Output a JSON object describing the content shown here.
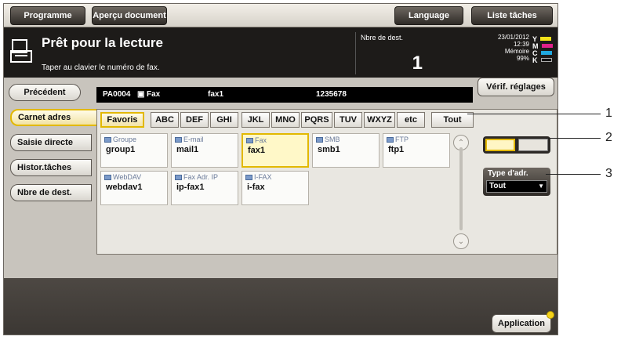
{
  "topbar": {
    "programme": "Programme",
    "apercu": "Aperçu document",
    "language": "Language",
    "liste_taches": "Liste tâches"
  },
  "status": {
    "title": "Prêt pour la lecture",
    "subtitle": "Taper au clavier le numéro de fax.",
    "dest_label": "Nbre de dest.",
    "dest_count": "1",
    "date": "23/01/2012",
    "time": "12:39",
    "memory_label": "Mémoire",
    "memory_value": "99%",
    "toner": [
      {
        "letter": "Y",
        "color": "#f2e21a"
      },
      {
        "letter": "M",
        "color": "#e0208a"
      },
      {
        "letter": "C",
        "color": "#20a9e0"
      },
      {
        "letter": "K",
        "color": "#111111"
      }
    ]
  },
  "nav": {
    "precedent": "Précédent",
    "verif_reglages": "Vérif. réglages"
  },
  "dest_strip": {
    "id": "PA0004",
    "type": "Fax",
    "name": "fax1",
    "number": "1235678"
  },
  "side_tabs": [
    "Carnet adres",
    "Saisie directe",
    "Histor.tâches",
    "Nbre de dest."
  ],
  "index_tabs": [
    "Favoris",
    "ABC",
    "DEF",
    "GHI",
    "JKL",
    "MNO",
    "PQRS",
    "TUV",
    "WXYZ",
    "etc",
    "Tout"
  ],
  "cards": [
    {
      "type": "Groupe",
      "name": "group1"
    },
    {
      "type": "E-mail",
      "name": "mail1"
    },
    {
      "type": "Fax",
      "name": "fax1"
    },
    {
      "type": "SMB",
      "name": "smb1"
    },
    {
      "type": "FTP",
      "name": "ftp1"
    },
    {
      "type": "WebDAV",
      "name": "webdav1"
    },
    {
      "type": "Fax Adr. IP",
      "name": "ip-fax1"
    },
    {
      "type": "I-FAX",
      "name": "i-fax"
    }
  ],
  "type_adr": {
    "label": "Type d'adr.",
    "value": "Tout"
  },
  "application": "Application",
  "callouts": [
    "1",
    "2",
    "3"
  ]
}
